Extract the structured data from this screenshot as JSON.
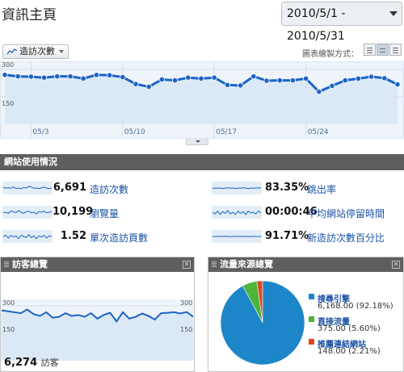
{
  "header": {
    "title": "資訊主頁",
    "date_range": "2010/5/1 - 2010/5/31"
  },
  "graph_controls": {
    "metric": "造訪次數",
    "graph_mode_label": "圖表繪製方式："
  },
  "colors": {
    "line": "#1c63c5",
    "fill": "#d6e6f5",
    "section_bar": "#5f5f5f",
    "link": "#1a52a5",
    "pie_search": "#1d86c8",
    "pie_direct": "#4cb33b",
    "pie_referral": "#e2461f"
  },
  "chart_data": [
    {
      "type": "line",
      "name": "main-visits",
      "x_tick_labels": [
        "05/3",
        "05/10",
        "05/17",
        "05/24"
      ],
      "y_tick_labels": [
        "300",
        "150"
      ],
      "ylim": [
        0,
        300
      ],
      "x": [
        "5/1",
        "5/2",
        "5/3",
        "5/4",
        "5/5",
        "5/6",
        "5/7",
        "5/8",
        "5/9",
        "5/10",
        "5/11",
        "5/12",
        "5/13",
        "5/14",
        "5/15",
        "5/16",
        "5/17",
        "5/18",
        "5/19",
        "5/20",
        "5/21",
        "5/22",
        "5/23",
        "5/24",
        "5/25",
        "5/26",
        "5/27",
        "5/28",
        "5/29",
        "5/30",
        "5/31"
      ],
      "values": [
        270,
        262,
        260,
        255,
        262,
        262,
        250,
        270,
        268,
        258,
        220,
        205,
        245,
        240,
        255,
        250,
        255,
        215,
        212,
        262,
        238,
        240,
        240,
        250,
        178,
        210,
        240,
        250,
        260,
        252,
        218
      ],
      "grid": true
    },
    {
      "type": "line",
      "name": "visitors-overview",
      "y_tick_labels": [
        "300",
        "150"
      ],
      "ylim": [
        0,
        300
      ],
      "values": [
        275,
        270,
        265,
        260,
        280,
        255,
        245,
        265,
        235,
        240,
        260,
        245,
        250,
        240,
        260,
        230,
        250,
        262,
        215,
        265,
        230,
        240,
        258,
        245,
        225,
        260,
        262,
        265,
        258,
        266,
        240
      ],
      "grid": true
    },
    {
      "type": "pie",
      "name": "traffic-sources",
      "labels": [
        "搜尋引擎",
        "直接流量",
        "推薦連結網站"
      ],
      "values": [
        6168,
        375,
        148
      ],
      "percents": [
        92.18,
        5.6,
        2.21
      ]
    }
  ],
  "site_usage": {
    "title": "網站使用情況",
    "stats": [
      {
        "value": "6,691",
        "label": "造訪次數",
        "spark": [
          0.55,
          0.5,
          0.52,
          0.48,
          0.6,
          0.45,
          0.5,
          0.42,
          0.55,
          0.5,
          0.62,
          0.6,
          0.48,
          0.5,
          0.45,
          0.52,
          0.58,
          0.5,
          0.45,
          0.5
        ]
      },
      {
        "value": "10,199",
        "label": "瀏覽量",
        "spark": [
          0.45,
          0.5,
          0.4,
          0.6,
          0.55,
          0.45,
          0.65,
          0.5,
          0.4,
          0.55,
          0.6,
          0.45,
          0.5,
          0.35,
          0.55,
          0.5,
          0.6,
          0.45,
          0.5,
          0.55
        ]
      },
      {
        "value": "1.52",
        "label": "單次造訪頁數",
        "spark": [
          0.5,
          0.6,
          0.35,
          0.6,
          0.45,
          0.55,
          0.3,
          0.6,
          0.5,
          0.4,
          0.65,
          0.4,
          0.55,
          0.3,
          0.55,
          0.45,
          0.6,
          0.35,
          0.55,
          0.5
        ]
      },
      {
        "value": "83.35%",
        "label": "跳出率",
        "spark": [
          0.45,
          0.5,
          0.48,
          0.5,
          0.45,
          0.5,
          0.52,
          0.48,
          0.5,
          0.45,
          0.5,
          0.48,
          0.52,
          0.5,
          0.45,
          0.5,
          0.48,
          0.5,
          0.52,
          0.5
        ]
      },
      {
        "value": "00:00:46",
        "label": "平均網站停留時間",
        "spark": [
          0.5,
          0.35,
          0.6,
          0.3,
          0.55,
          0.4,
          0.65,
          0.35,
          0.5,
          0.3,
          0.6,
          0.4,
          0.55,
          0.3,
          0.6,
          0.45,
          0.5,
          0.35,
          0.6,
          0.45
        ]
      },
      {
        "value": "91.71%",
        "label": "新造訪次數百分比",
        "spark": [
          0.5,
          0.48,
          0.52,
          0.5,
          0.49,
          0.51,
          0.5,
          0.48,
          0.5,
          0.52,
          0.5,
          0.49,
          0.51,
          0.5,
          0.48,
          0.5,
          0.52,
          0.5,
          0.49,
          0.5
        ]
      }
    ]
  },
  "visitors_panel": {
    "title": "訪客總覽",
    "total_value": "6,274",
    "total_label": "訪客"
  },
  "traffic_panel": {
    "title": "流量來源總覽",
    "legend": [
      {
        "name": "搜尋引擎",
        "detail": "6,168.00 (92.18%)"
      },
      {
        "name": "直接流量",
        "detail": "375.00 (5.60%)"
      },
      {
        "name": "推薦連結網站",
        "detail": "148.00 (2.21%)"
      }
    ]
  }
}
